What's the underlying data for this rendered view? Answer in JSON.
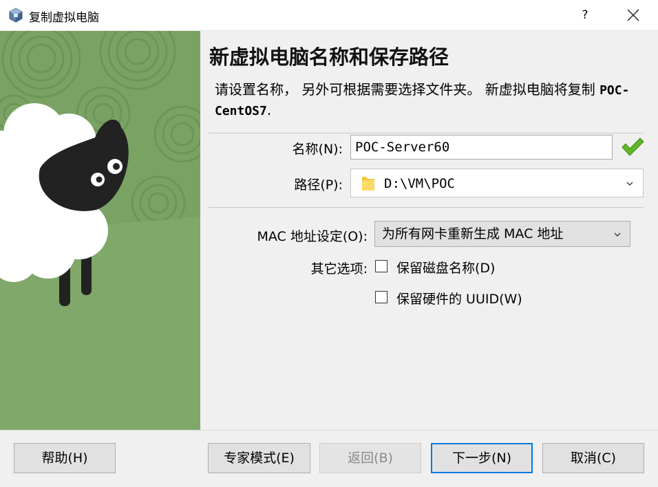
{
  "window": {
    "title": "复制虚拟电脑",
    "help_label": "?",
    "icon": "virtualbox-icon"
  },
  "page": {
    "heading": "新虚拟电脑名称和保存路径",
    "description": "请设置名称， 另外可根据需要选择文件夹。 新虚拟电脑将复制 ",
    "source_vm": "POC-CentOS7",
    "description_end": "."
  },
  "form": {
    "name_label": "名称(N):",
    "name_value": "POC-Server60",
    "path_label": "路径(P):",
    "path_value": "D:\\VM\\POC",
    "mac_label": "MAC 地址设定(O):",
    "mac_value": "为所有网卡重新生成 MAC 地址",
    "other_options_label": "其它选项:",
    "keep_disk_names_label": "保留磁盘名称(D)",
    "keep_disk_names_checked": false,
    "keep_hardware_uuid_label": "保留硬件的 UUID(W)",
    "keep_hardware_uuid_checked": false
  },
  "buttons": {
    "help": "帮助(H)",
    "expert_mode": "专家模式(E)",
    "back": "返回(B)",
    "next": "下一步(N)",
    "cancel": "取消(C)"
  },
  "colors": {
    "accent": "#0078d7",
    "valid_check": "#5fb827",
    "art_green": "#7aa363",
    "art_pattern": "#6c955a"
  }
}
